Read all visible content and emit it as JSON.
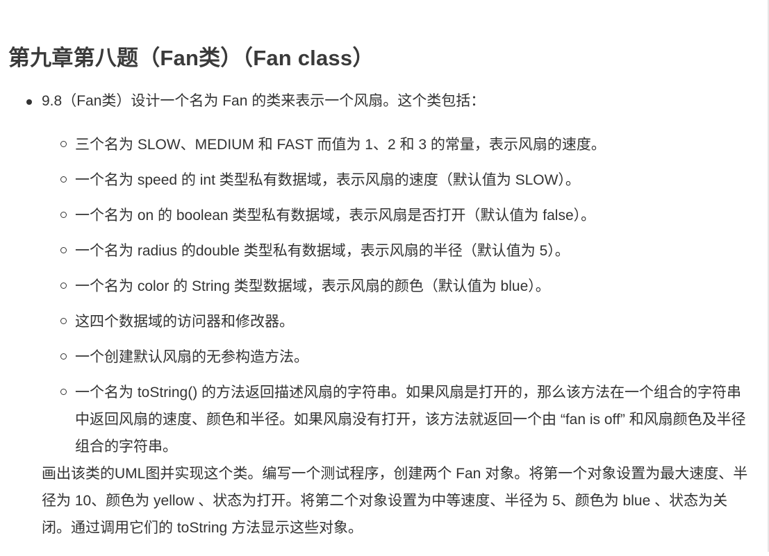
{
  "heading": "第九章第八题（Fan类）（Fan class）",
  "intro": "9.8（Fan类）设计一个名为 Fan 的类来表示一个风扇。这个类包括：",
  "requirements": [
    "三个名为 SLOW、MEDIUM 和 FAST 而值为 1、2 和 3 的常量，表示风扇的速度。",
    "一个名为 speed 的 int 类型私有数据域，表示风扇的速度（默认值为 SLOW）。",
    "一个名为 on 的 boolean 类型私有数据域，表示风扇是否打开（默认值为 false）。",
    "一个名为 radius 的double 类型私有数据域，表示风扇的半径（默认值为 5）。",
    "一个名为 color 的 String 类型数据域，表示风扇的颜色（默认值为 blue）。",
    "这四个数据域的访问器和修改器。",
    "一个创建默认风扇的无参构造方法。",
    "一个名为 toString() 的方法返回描述风扇的字符串。如果风扇是打开的，那么该方法在一个组合的字符串中返回风扇的速度、颜色和半径。如果风扇没有打开，该方法就返回一个由 “fan is off” 和风扇颜色及半径组合的字符串。"
  ],
  "task": "画出该类的UML图并实现这个类。编写一个测试程序，创建两个 Fan 对象。将第一个对象设置为最大速度、半径为 10、颜色为 yellow 、状态为打开。将第二个对象设置为中等速度、半径为 5、颜色为 blue 、状态为关闭。通过调用它们的 toString 方法显示这些对象。"
}
